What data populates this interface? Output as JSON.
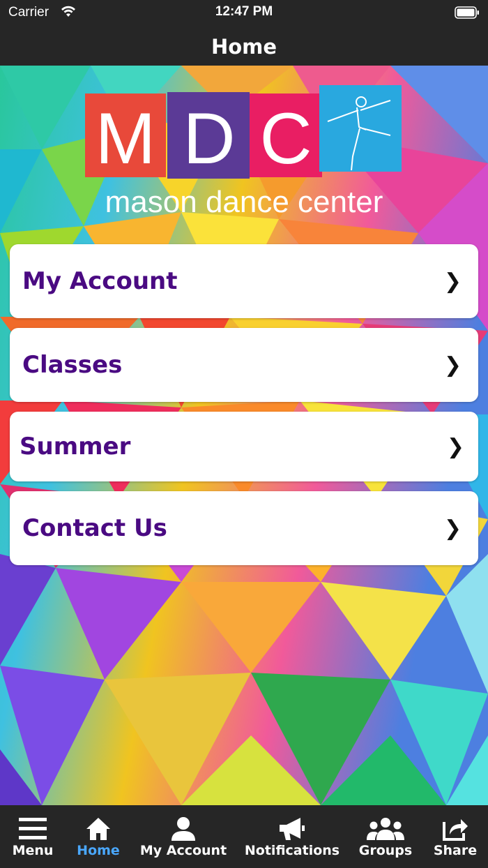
{
  "status_bar": {
    "carrier": "Carrier",
    "time": "12:47 PM"
  },
  "nav": {
    "title": "Home"
  },
  "logo": {
    "letters": [
      "M",
      "D",
      "C"
    ],
    "tagline": "mason dance center",
    "colors": [
      "#e8493a",
      "#5b3a96",
      "#e91e63",
      "#29a8df"
    ]
  },
  "menu": [
    {
      "label": "My Account",
      "chevron": "❯"
    },
    {
      "label": "Classes",
      "chevron": "❯"
    },
    {
      "label": "Summer",
      "chevron": "❯"
    },
    {
      "label": "Contact Us",
      "chevron": "❯"
    }
  ],
  "tabs": [
    {
      "label": "Menu",
      "icon": "hamburger-icon",
      "active": false
    },
    {
      "label": "Home",
      "icon": "home-icon",
      "active": true
    },
    {
      "label": "My Account",
      "icon": "person-icon",
      "active": false
    },
    {
      "label": "Notifications",
      "icon": "megaphone-icon",
      "active": false
    },
    {
      "label": "Groups",
      "icon": "group-icon",
      "active": false
    },
    {
      "label": "Share",
      "icon": "share-icon",
      "active": false
    }
  ],
  "colors": {
    "menu_text": "#4a0a82",
    "bar_bg": "#262626",
    "active_tab": "#4aa8ff"
  }
}
